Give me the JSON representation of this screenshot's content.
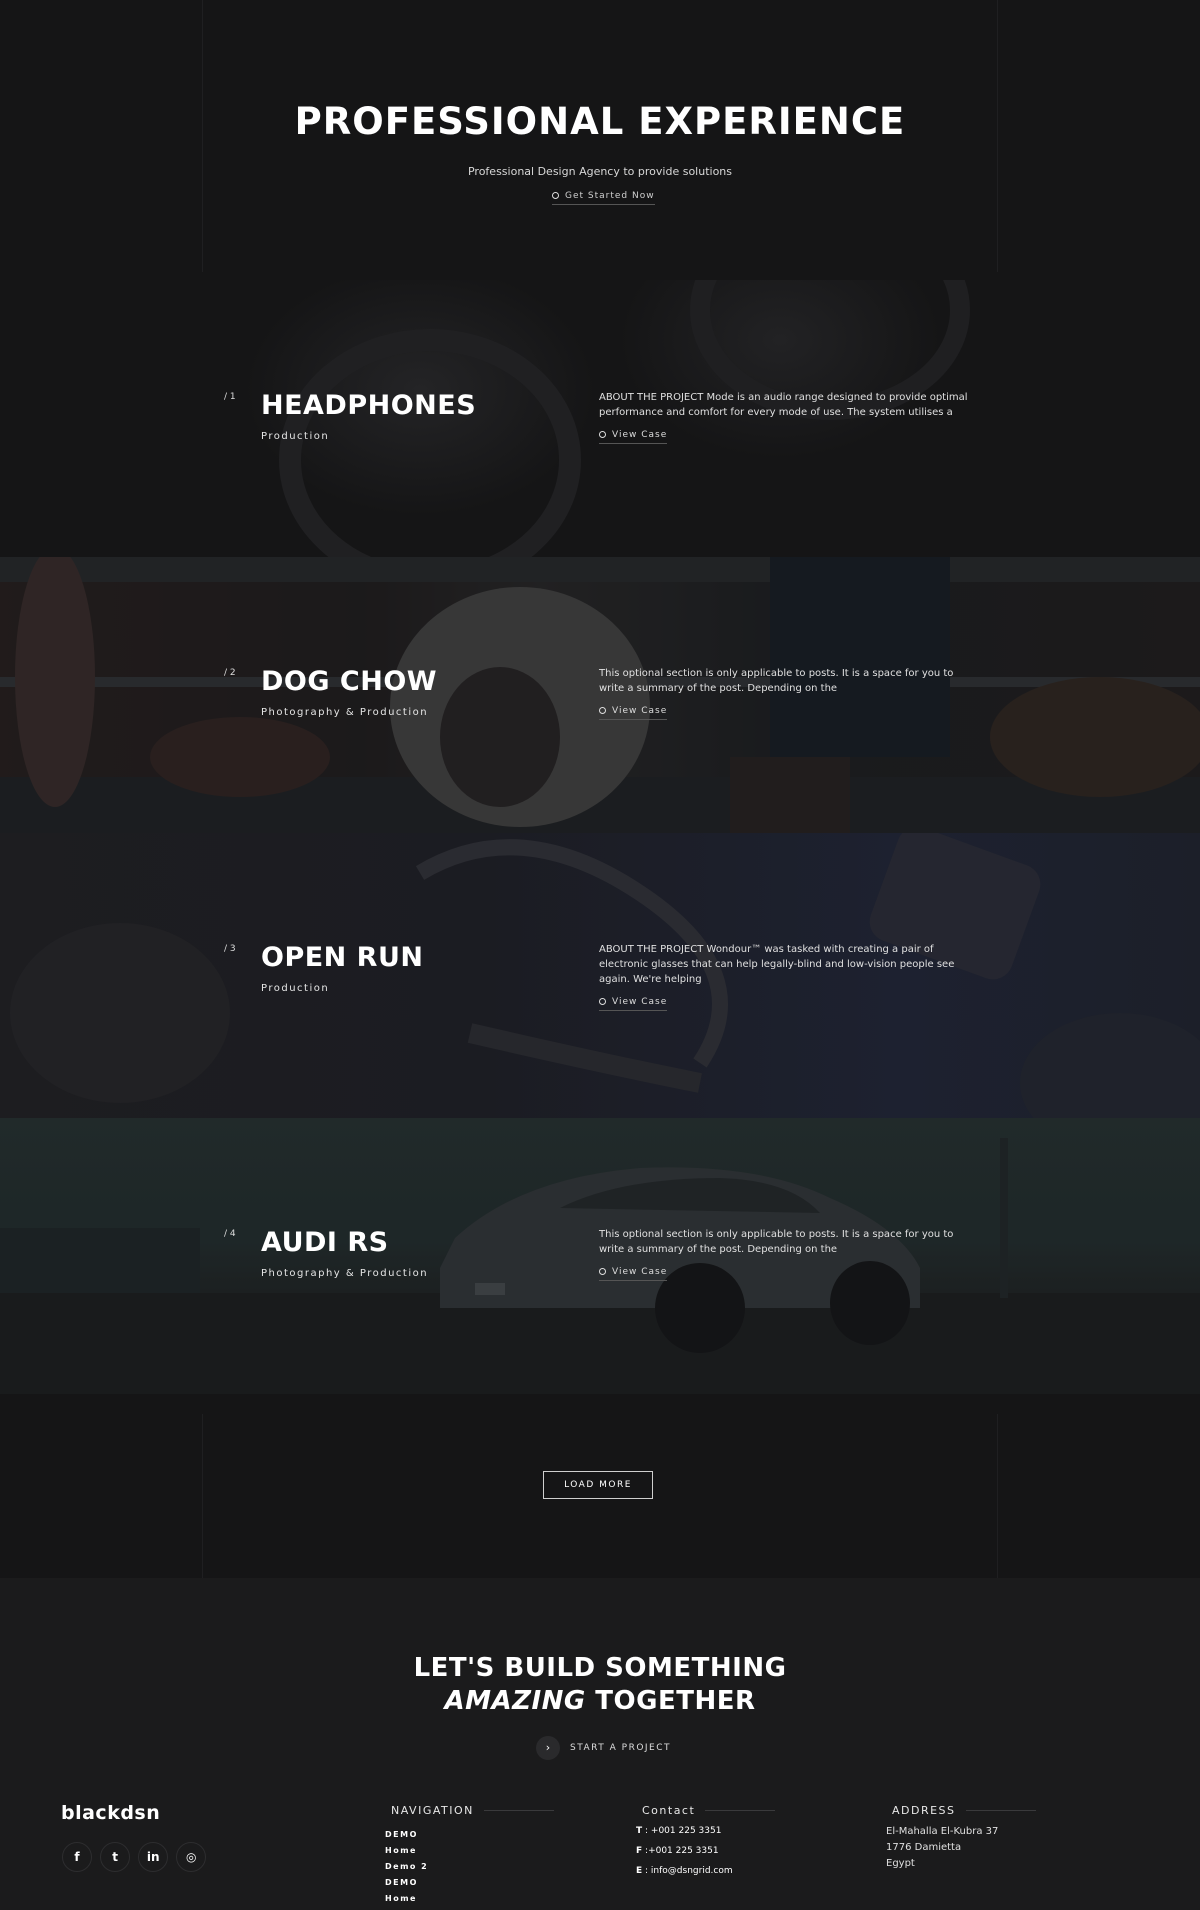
{
  "hero": {
    "title": "PROFESSIONAL EXPERIENCE",
    "subtitle": "Professional Design Agency to provide solutions",
    "cta": "Get Started Now"
  },
  "projects": [
    {
      "number": "/ 1",
      "title": "HEADPHONES",
      "category": "Production",
      "description": "ABOUT THE PROJECT Mode is an audio range designed to provide optimal performance and comfort for every mode of use. The system utilises a",
      "cta": "View Case"
    },
    {
      "number": "/ 2",
      "title": "DOG CHOW",
      "category": "Photography & Production",
      "description": "This optional section is only applicable to posts. It is a space for you to write a summary of the post. Depending on the",
      "cta": "View Case"
    },
    {
      "number": "/ 3",
      "title": "OPEN RUN",
      "category": "Production",
      "description": "ABOUT THE PROJECT Wondour™ was tasked with creating a pair of electronic glasses that can help legally-blind and low-vision people see again. We're helping",
      "cta": "View Case"
    },
    {
      "number": "/ 4",
      "title": "AUDI RS",
      "category": "Photography & Production",
      "description": "This optional section is only applicable to posts. It is a space for you to write a summary of the post. Depending on the",
      "cta": "View Case"
    }
  ],
  "load_more": "LOAD MORE",
  "footer": {
    "cta_line1": "LET'S BUILD SOMETHING",
    "cta_emph": "AMAZING",
    "cta_rest": "TOGETHER",
    "start_arrow": "›",
    "start_label": "START A PROJECT",
    "logo": "blackdsn",
    "socials": [
      {
        "icon": "facebook-icon",
        "glyph": "f"
      },
      {
        "icon": "twitter-icon",
        "glyph": "t"
      },
      {
        "icon": "linkedin-icon",
        "glyph": "in"
      },
      {
        "icon": "instagram-icon",
        "glyph": "◎"
      }
    ],
    "navigation": {
      "heading": "NAVIGATION",
      "items": [
        "DEMO",
        "Home",
        "Demo 2",
        "DEMO",
        "Home"
      ]
    },
    "contact": {
      "heading": "Contact",
      "t_label": "T",
      "t_value": ": +001 225 3351",
      "f_label": "F",
      "f_value": ":+001 225 3351",
      "e_label": "E",
      "e_value": ": info@dsngrid.com"
    },
    "address": {
      "heading": "ADDRESS",
      "line1": "El-Mahalla El-Kubra 37",
      "line2": "1776 Damietta",
      "line3": "Egypt"
    }
  },
  "colors": {
    "background": "#141415",
    "footer": "#1b1b1c",
    "text": "#ffffff"
  }
}
